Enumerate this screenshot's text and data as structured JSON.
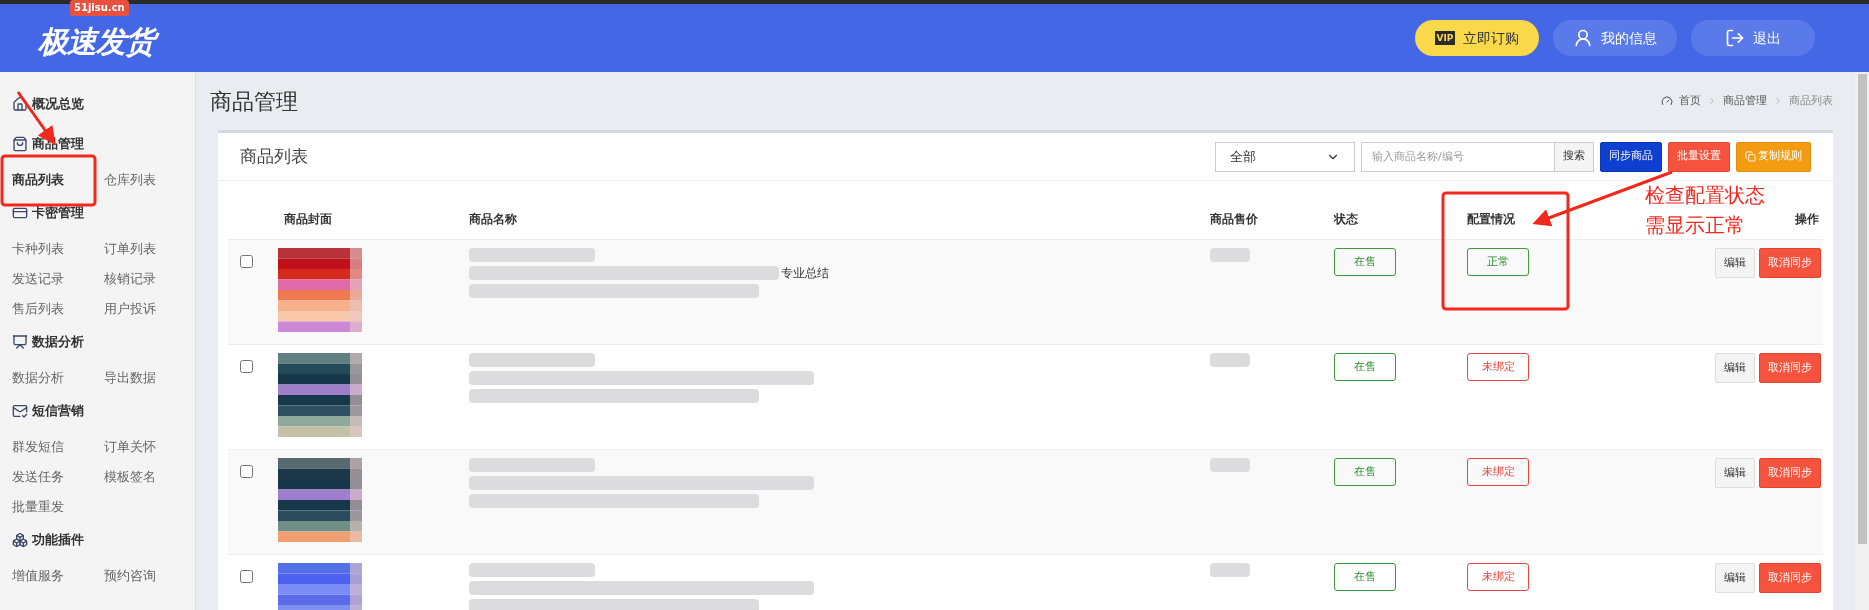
{
  "header": {
    "logo": "极速发货",
    "logo_badge": "51jisu.cn",
    "buttons": [
      {
        "kind": "vip",
        "badge": "VIP",
        "label": "立即订购"
      },
      {
        "kind": "user",
        "label": "我的信息"
      },
      {
        "kind": "logout",
        "label": "退出"
      }
    ]
  },
  "sidebar": {
    "sections": [
      {
        "title": "概况总览"
      },
      {
        "title": "商品管理",
        "items": [
          {
            "label": "商品列表",
            "selected": true
          },
          {
            "label": "仓库列表",
            "selected": false
          }
        ]
      },
      {
        "title": "卡密管理",
        "items": [
          {
            "label": "卡种列表",
            "selected": false
          },
          {
            "label": "订单列表",
            "selected": false
          },
          {
            "label": "发送记录",
            "selected": false
          },
          {
            "label": "核销记录",
            "selected": false
          },
          {
            "label": "售后列表",
            "selected": false
          },
          {
            "label": "用户投诉",
            "selected": false
          }
        ]
      },
      {
        "title": "数据分析",
        "items": [
          {
            "label": "数据分析",
            "selected": false
          },
          {
            "label": "导出数据",
            "selected": false
          }
        ]
      },
      {
        "title": "短信营销",
        "items": [
          {
            "label": "群发短信",
            "selected": false
          },
          {
            "label": "订单关怀",
            "selected": false
          },
          {
            "label": "发送任务",
            "selected": false
          },
          {
            "label": "模板签名",
            "selected": false
          },
          {
            "label": "批量重发",
            "selected": false
          }
        ]
      },
      {
        "title": "功能插件",
        "items": [
          {
            "label": "增值服务",
            "selected": false
          },
          {
            "label": "预约咨询",
            "selected": false
          }
        ]
      }
    ]
  },
  "page_title": "商品管理",
  "breadcrumb": [
    "首页",
    "商品管理",
    "商品列表"
  ],
  "card": {
    "title": "商品列表",
    "filter": "全部",
    "search": {
      "placeholder": "输入商品名称/编号",
      "button": "搜索"
    },
    "buttons": [
      {
        "label": "同步商品",
        "kind": "primary"
      },
      {
        "label": "批量设置",
        "kind": "danger"
      },
      {
        "label": "复制规则",
        "kind": "warning"
      }
    ]
  },
  "table": {
    "columns": [
      "商品封面",
      "商品名称",
      "商品售价",
      "状态",
      "配置情况",
      "操作"
    ],
    "rows": [
      {
        "checked": false,
        "name_tail": "专业总结",
        "status": "在售",
        "config": {
          "label": "正常",
          "kind": "ok"
        },
        "actions": [
          "编辑",
          "取消同步"
        ]
      },
      {
        "checked": false,
        "status": "在售",
        "config": {
          "label": "未绑定",
          "kind": "unbound"
        },
        "actions": [
          "编辑",
          "取消同步"
        ]
      },
      {
        "checked": false,
        "status": "在售",
        "config": {
          "label": "未绑定",
          "kind": "unbound"
        },
        "actions": [
          "编辑",
          "取消同步"
        ]
      },
      {
        "checked": false,
        "status": "在售",
        "config": {
          "label": "未绑定",
          "kind": "unbound"
        },
        "actions": [
          "编辑",
          "取消同步"
        ]
      }
    ]
  },
  "annotation": {
    "note": [
      "检查配置状态",
      "需显示正常"
    ]
  }
}
